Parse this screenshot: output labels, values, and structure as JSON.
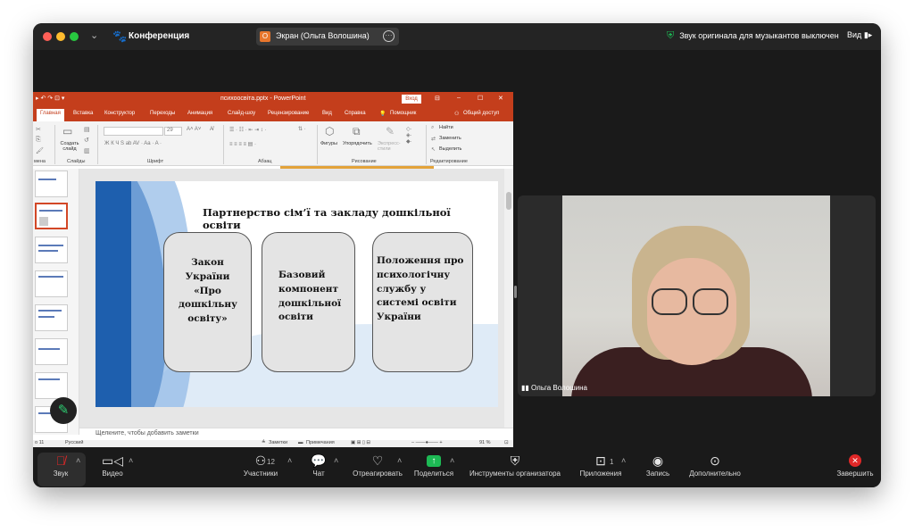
{
  "titlebar": {
    "app_title": "Конференция",
    "share_badge": "О",
    "share_label": "Экран (Ольга Волошина)",
    "original_sound_status": "Звук оригинала для музыкантов выключен",
    "view_label": "Вид"
  },
  "powerpoint": {
    "window_title": "психоосвіта.pptx  -  PowerPoint",
    "login_label": "Вход",
    "tabs": [
      "Главная",
      "Вставка",
      "Конструктор",
      "Переходы",
      "Анимация",
      "Слайд-шоу",
      "Рецензирование",
      "Вид",
      "Справка",
      "Помощник"
    ],
    "share_label": "Общий доступ",
    "ribbon": {
      "group_clipboard": "мена",
      "group_slides": "Слайды",
      "group_font": "Шрифт",
      "group_paragraph": "Абзац",
      "group_drawing": "Рисование",
      "group_editing": "Редактирование",
      "create_slide": "Создать слайд",
      "font_size": "29",
      "shapes": "Фигуры",
      "arrange": "Упорядочить",
      "express_styles": "Экспресс-стили",
      "find": "Найти",
      "replace": "Заменить",
      "select": "Выделить"
    },
    "slide": {
      "title": "Партнерство сім’ї та закладу дошкільної освіти",
      "box1": "Закон України «Про дошкільну освіту»",
      "box2": "Базовий компонент дошкільної освіти",
      "box3": "Положення про психологічну службу у системі освіти України"
    },
    "notes_placeholder": "Щелкните, чтобы добавить заметки",
    "status": {
      "slide_counter": "о 11",
      "language": "Русский",
      "notes": "Заметки",
      "comments": "Примечания",
      "zoom": "91 %"
    }
  },
  "video": {
    "participant_name": "Ольга Волошина"
  },
  "toolbar": {
    "sound": "Звук",
    "video": "Видео",
    "participants": "Участники",
    "participants_count": "12",
    "chat": "Чат",
    "react": "Отреагировать",
    "share": "Поделиться",
    "host_tools": "Инструменты организатора",
    "apps": "Приложения",
    "apps_count": "1",
    "record": "Запись",
    "more": "Дополнительно",
    "end": "Завершить"
  },
  "colors": {
    "zoom_bg": "#1a1a1a",
    "ppt_accent": "#c43e1c",
    "share_green": "#1db954",
    "end_red": "#e02828"
  }
}
